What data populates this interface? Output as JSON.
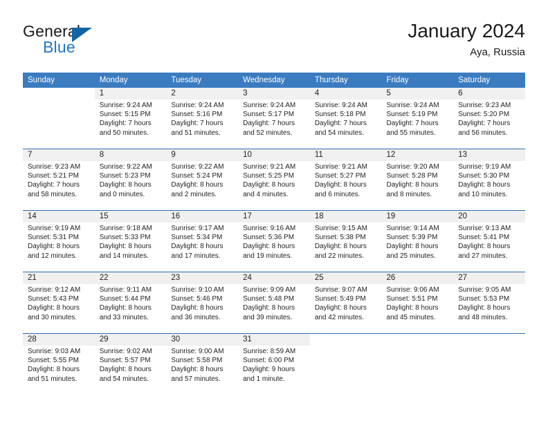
{
  "brand": {
    "word1": "General",
    "word2": "Blue",
    "flag_color": "#1464a5",
    "blue_color": "#2076c4"
  },
  "header": {
    "title": "January 2024",
    "location": "Aya, Russia"
  },
  "theme": {
    "header_bg": "#3b7cc0",
    "week_divider": "#2b6cad",
    "daynum_band": "#f0f0f0"
  },
  "weekdays": [
    "Sunday",
    "Monday",
    "Tuesday",
    "Wednesday",
    "Thursday",
    "Friday",
    "Saturday"
  ],
  "weeks": [
    [
      {
        "day": "",
        "lines": []
      },
      {
        "day": "1",
        "lines": [
          "Sunrise: 9:24 AM",
          "Sunset: 5:15 PM",
          "Daylight: 7 hours",
          "and 50 minutes."
        ]
      },
      {
        "day": "2",
        "lines": [
          "Sunrise: 9:24 AM",
          "Sunset: 5:16 PM",
          "Daylight: 7 hours",
          "and 51 minutes."
        ]
      },
      {
        "day": "3",
        "lines": [
          "Sunrise: 9:24 AM",
          "Sunset: 5:17 PM",
          "Daylight: 7 hours",
          "and 52 minutes."
        ]
      },
      {
        "day": "4",
        "lines": [
          "Sunrise: 9:24 AM",
          "Sunset: 5:18 PM",
          "Daylight: 7 hours",
          "and 54 minutes."
        ]
      },
      {
        "day": "5",
        "lines": [
          "Sunrise: 9:24 AM",
          "Sunset: 5:19 PM",
          "Daylight: 7 hours",
          "and 55 minutes."
        ]
      },
      {
        "day": "6",
        "lines": [
          "Sunrise: 9:23 AM",
          "Sunset: 5:20 PM",
          "Daylight: 7 hours",
          "and 56 minutes."
        ]
      }
    ],
    [
      {
        "day": "7",
        "lines": [
          "Sunrise: 9:23 AM",
          "Sunset: 5:21 PM",
          "Daylight: 7 hours",
          "and 58 minutes."
        ]
      },
      {
        "day": "8",
        "lines": [
          "Sunrise: 9:22 AM",
          "Sunset: 5:23 PM",
          "Daylight: 8 hours",
          "and 0 minutes."
        ]
      },
      {
        "day": "9",
        "lines": [
          "Sunrise: 9:22 AM",
          "Sunset: 5:24 PM",
          "Daylight: 8 hours",
          "and 2 minutes."
        ]
      },
      {
        "day": "10",
        "lines": [
          "Sunrise: 9:21 AM",
          "Sunset: 5:25 PM",
          "Daylight: 8 hours",
          "and 4 minutes."
        ]
      },
      {
        "day": "11",
        "lines": [
          "Sunrise: 9:21 AM",
          "Sunset: 5:27 PM",
          "Daylight: 8 hours",
          "and 6 minutes."
        ]
      },
      {
        "day": "12",
        "lines": [
          "Sunrise: 9:20 AM",
          "Sunset: 5:28 PM",
          "Daylight: 8 hours",
          "and 8 minutes."
        ]
      },
      {
        "day": "13",
        "lines": [
          "Sunrise: 9:19 AM",
          "Sunset: 5:30 PM",
          "Daylight: 8 hours",
          "and 10 minutes."
        ]
      }
    ],
    [
      {
        "day": "14",
        "lines": [
          "Sunrise: 9:19 AM",
          "Sunset: 5:31 PM",
          "Daylight: 8 hours",
          "and 12 minutes."
        ]
      },
      {
        "day": "15",
        "lines": [
          "Sunrise: 9:18 AM",
          "Sunset: 5:33 PM",
          "Daylight: 8 hours",
          "and 14 minutes."
        ]
      },
      {
        "day": "16",
        "lines": [
          "Sunrise: 9:17 AM",
          "Sunset: 5:34 PM",
          "Daylight: 8 hours",
          "and 17 minutes."
        ]
      },
      {
        "day": "17",
        "lines": [
          "Sunrise: 9:16 AM",
          "Sunset: 5:36 PM",
          "Daylight: 8 hours",
          "and 19 minutes."
        ]
      },
      {
        "day": "18",
        "lines": [
          "Sunrise: 9:15 AM",
          "Sunset: 5:38 PM",
          "Daylight: 8 hours",
          "and 22 minutes."
        ]
      },
      {
        "day": "19",
        "lines": [
          "Sunrise: 9:14 AM",
          "Sunset: 5:39 PM",
          "Daylight: 8 hours",
          "and 25 minutes."
        ]
      },
      {
        "day": "20",
        "lines": [
          "Sunrise: 9:13 AM",
          "Sunset: 5:41 PM",
          "Daylight: 8 hours",
          "and 27 minutes."
        ]
      }
    ],
    [
      {
        "day": "21",
        "lines": [
          "Sunrise: 9:12 AM",
          "Sunset: 5:43 PM",
          "Daylight: 8 hours",
          "and 30 minutes."
        ]
      },
      {
        "day": "22",
        "lines": [
          "Sunrise: 9:11 AM",
          "Sunset: 5:44 PM",
          "Daylight: 8 hours",
          "and 33 minutes."
        ]
      },
      {
        "day": "23",
        "lines": [
          "Sunrise: 9:10 AM",
          "Sunset: 5:46 PM",
          "Daylight: 8 hours",
          "and 36 minutes."
        ]
      },
      {
        "day": "24",
        "lines": [
          "Sunrise: 9:09 AM",
          "Sunset: 5:48 PM",
          "Daylight: 8 hours",
          "and 39 minutes."
        ]
      },
      {
        "day": "25",
        "lines": [
          "Sunrise: 9:07 AM",
          "Sunset: 5:49 PM",
          "Daylight: 8 hours",
          "and 42 minutes."
        ]
      },
      {
        "day": "26",
        "lines": [
          "Sunrise: 9:06 AM",
          "Sunset: 5:51 PM",
          "Daylight: 8 hours",
          "and 45 minutes."
        ]
      },
      {
        "day": "27",
        "lines": [
          "Sunrise: 9:05 AM",
          "Sunset: 5:53 PM",
          "Daylight: 8 hours",
          "and 48 minutes."
        ]
      }
    ],
    [
      {
        "day": "28",
        "lines": [
          "Sunrise: 9:03 AM",
          "Sunset: 5:55 PM",
          "Daylight: 8 hours",
          "and 51 minutes."
        ]
      },
      {
        "day": "29",
        "lines": [
          "Sunrise: 9:02 AM",
          "Sunset: 5:57 PM",
          "Daylight: 8 hours",
          "and 54 minutes."
        ]
      },
      {
        "day": "30",
        "lines": [
          "Sunrise: 9:00 AM",
          "Sunset: 5:58 PM",
          "Daylight: 8 hours",
          "and 57 minutes."
        ]
      },
      {
        "day": "31",
        "lines": [
          "Sunrise: 8:59 AM",
          "Sunset: 6:00 PM",
          "Daylight: 9 hours",
          "and 1 minute."
        ]
      },
      {
        "day": "",
        "lines": []
      },
      {
        "day": "",
        "lines": []
      },
      {
        "day": "",
        "lines": []
      }
    ]
  ]
}
